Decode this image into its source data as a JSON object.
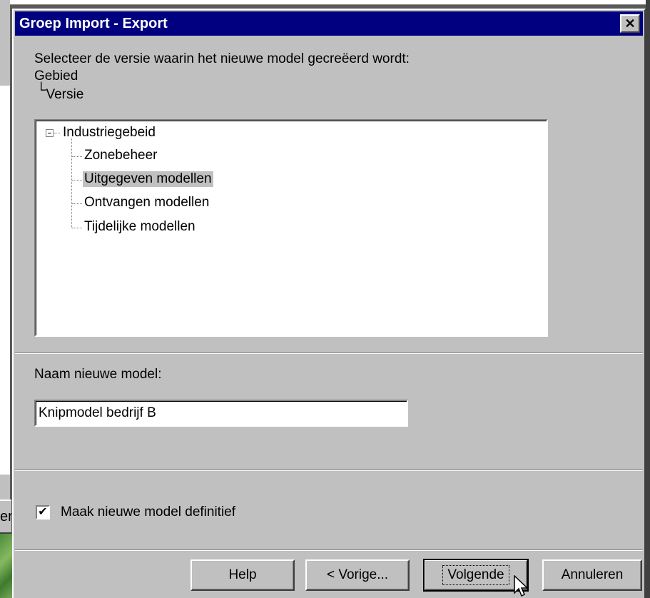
{
  "background": {
    "partial_button_label": "er"
  },
  "dialog": {
    "title": "Groep Import - Export",
    "close_label": "✕",
    "instruction": "Selecteer de versie waarin het nieuwe model gecreëerd wordt:",
    "legend_level1": "Gebied",
    "legend_level2": "Versie",
    "tree": {
      "root": "Industriegebeid",
      "children": [
        "Zonebeheer",
        "Uitgegeven modellen",
        "Ontvangen modellen",
        "Tijdelijke modellen"
      ],
      "selected_child": "Uitgegeven modellen"
    },
    "name_label": "Naam nieuwe model:",
    "name_value": "Knipmodel bedrijf B",
    "definitive_checkbox": {
      "label": "Maak nieuwe model definitief",
      "checked": true
    },
    "buttons": {
      "help": "Help",
      "back": "< Vorige...",
      "next": "Volgende",
      "cancel": "Annuleren"
    }
  }
}
